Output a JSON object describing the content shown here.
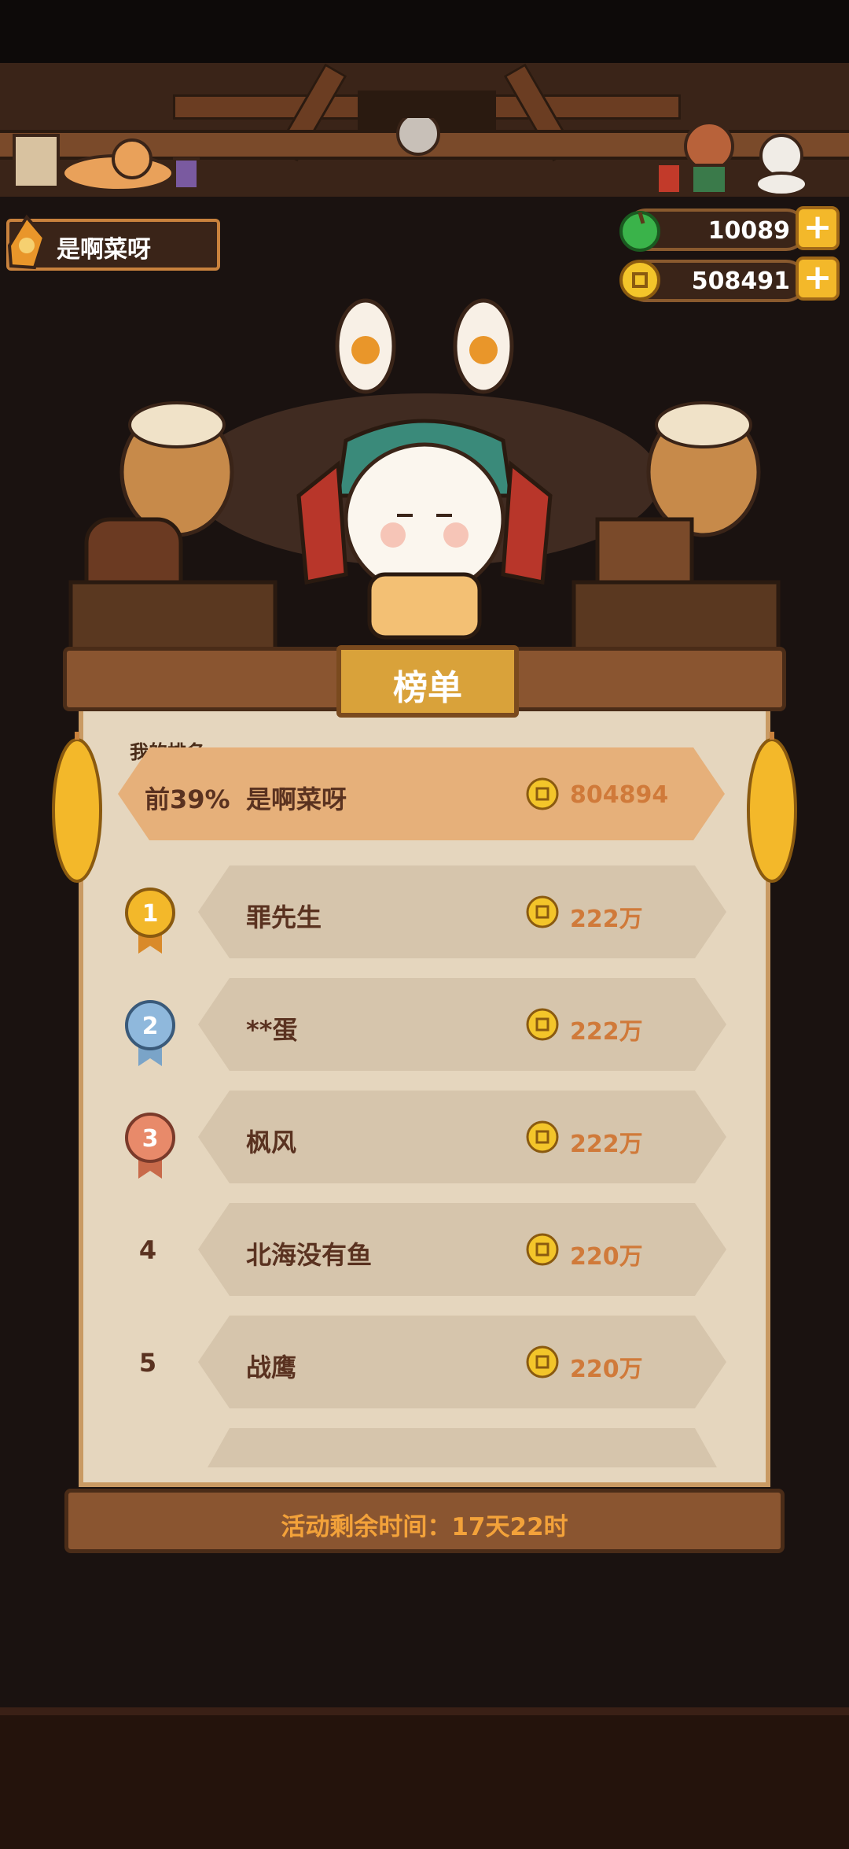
{
  "header": {
    "player_name": "是啊菜呀",
    "currencies": [
      {
        "icon": "green-gem-icon",
        "value": "10089"
      },
      {
        "icon": "gold-coin-icon",
        "value": "508491"
      }
    ]
  },
  "leaderboard": {
    "title": "榜单",
    "my_rank_label": "我的排名",
    "my_rank": {
      "percent": "前39%",
      "name": "是啊菜呀",
      "score": "804894"
    },
    "rows": [
      {
        "rank": "1",
        "name": "罪先生",
        "score": "222万"
      },
      {
        "rank": "2",
        "name": "**蛋",
        "score": "222万"
      },
      {
        "rank": "3",
        "name": "枫风",
        "score": "222万"
      },
      {
        "rank": "4",
        "name": "北海没有鱼",
        "score": "220万"
      },
      {
        "rank": "5",
        "name": "战鹰",
        "score": "220万"
      }
    ],
    "timer": "活动剩余时间：17天22时"
  },
  "colors": {
    "accent": "#d9a23a",
    "score": "#d07a3a",
    "panel": "#e5d6be"
  }
}
